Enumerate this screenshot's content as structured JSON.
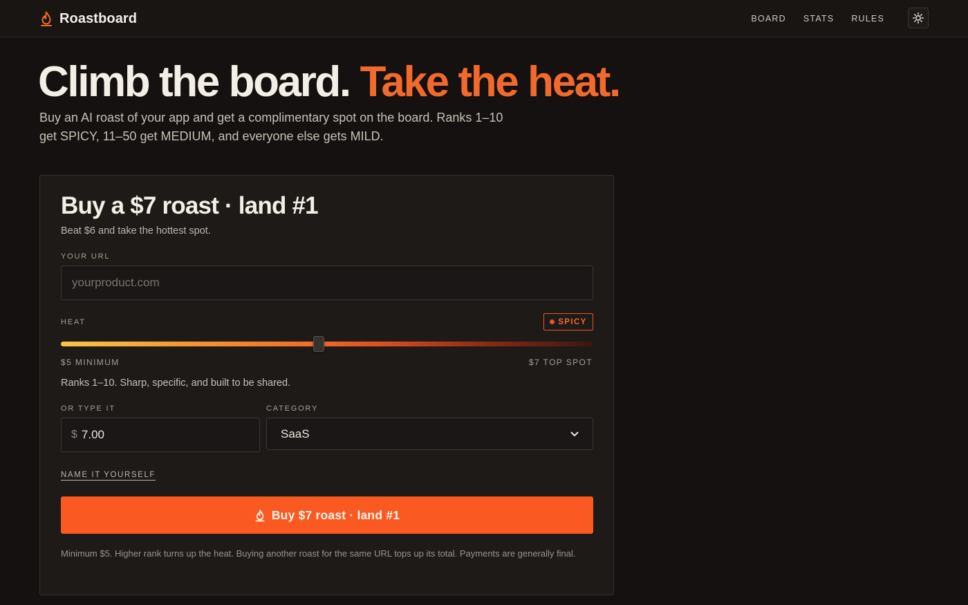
{
  "app": {
    "name": "Roastboard"
  },
  "nav": {
    "items": [
      "BOARD",
      "STATS",
      "RULES"
    ]
  },
  "hero": {
    "title_main": "Climb the board.",
    "title_accent": "Take the heat.",
    "subtitle": "Buy an AI roast of your app and get a complimentary spot on the board. Ranks 1–10 get SPICY, 11–50 get MEDIUM, and everyone else gets MILD."
  },
  "card": {
    "title": "Buy a $7 roast · land #1",
    "subtitle": "Beat $6 and take the hottest spot.",
    "url_label": "YOUR URL",
    "url_placeholder": "yourproduct.com",
    "url_value": "",
    "heat_label": "HEAT",
    "heat_badge": "SPICY",
    "slider_fraction": 0.485,
    "min_label": "$5 MINIMUM",
    "max_label": "$7 TOP SPOT",
    "heat_description": "Ranks 1–10. Sharp, specific, and built to be shared.",
    "type_label": "OR TYPE IT",
    "currency_symbol": "$",
    "amount_value": "7.00",
    "category_label": "CATEGORY",
    "category_value": "SaaS",
    "name_link": "NAME IT YOURSELF",
    "buy_button": "Buy $7 roast · land #1",
    "footnote": "Minimum $5. Higher rank turns up the heat. Buying another roast for the same URL tops up its total. Payments are generally final."
  },
  "colors": {
    "accent": "#f26a2b",
    "button": "#fa5a21",
    "background": "#141110",
    "card": "#1d1a18"
  },
  "icons": {
    "brand": "flame-icon",
    "theme_toggle": "sun-icon",
    "buy_button": "flame-icon",
    "select": "chevron-down-icon"
  }
}
